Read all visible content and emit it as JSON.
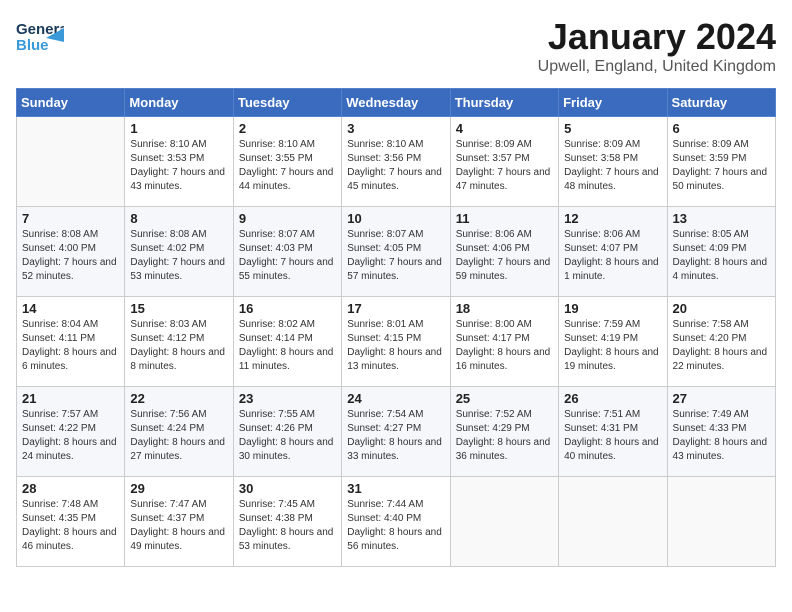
{
  "header": {
    "logo_line1": "General",
    "logo_line2": "Blue",
    "month": "January 2024",
    "location": "Upwell, England, United Kingdom"
  },
  "days_of_week": [
    "Sunday",
    "Monday",
    "Tuesday",
    "Wednesday",
    "Thursday",
    "Friday",
    "Saturday"
  ],
  "weeks": [
    [
      {
        "day": "",
        "info": ""
      },
      {
        "day": "1",
        "info": "Sunrise: 8:10 AM\nSunset: 3:53 PM\nDaylight: 7 hours\nand 43 minutes."
      },
      {
        "day": "2",
        "info": "Sunrise: 8:10 AM\nSunset: 3:55 PM\nDaylight: 7 hours\nand 44 minutes."
      },
      {
        "day": "3",
        "info": "Sunrise: 8:10 AM\nSunset: 3:56 PM\nDaylight: 7 hours\nand 45 minutes."
      },
      {
        "day": "4",
        "info": "Sunrise: 8:09 AM\nSunset: 3:57 PM\nDaylight: 7 hours\nand 47 minutes."
      },
      {
        "day": "5",
        "info": "Sunrise: 8:09 AM\nSunset: 3:58 PM\nDaylight: 7 hours\nand 48 minutes."
      },
      {
        "day": "6",
        "info": "Sunrise: 8:09 AM\nSunset: 3:59 PM\nDaylight: 7 hours\nand 50 minutes."
      }
    ],
    [
      {
        "day": "7",
        "info": "Sunrise: 8:08 AM\nSunset: 4:00 PM\nDaylight: 7 hours\nand 52 minutes."
      },
      {
        "day": "8",
        "info": "Sunrise: 8:08 AM\nSunset: 4:02 PM\nDaylight: 7 hours\nand 53 minutes."
      },
      {
        "day": "9",
        "info": "Sunrise: 8:07 AM\nSunset: 4:03 PM\nDaylight: 7 hours\nand 55 minutes."
      },
      {
        "day": "10",
        "info": "Sunrise: 8:07 AM\nSunset: 4:05 PM\nDaylight: 7 hours\nand 57 minutes."
      },
      {
        "day": "11",
        "info": "Sunrise: 8:06 AM\nSunset: 4:06 PM\nDaylight: 7 hours\nand 59 minutes."
      },
      {
        "day": "12",
        "info": "Sunrise: 8:06 AM\nSunset: 4:07 PM\nDaylight: 8 hours\nand 1 minute."
      },
      {
        "day": "13",
        "info": "Sunrise: 8:05 AM\nSunset: 4:09 PM\nDaylight: 8 hours\nand 4 minutes."
      }
    ],
    [
      {
        "day": "14",
        "info": "Sunrise: 8:04 AM\nSunset: 4:11 PM\nDaylight: 8 hours\nand 6 minutes."
      },
      {
        "day": "15",
        "info": "Sunrise: 8:03 AM\nSunset: 4:12 PM\nDaylight: 8 hours\nand 8 minutes."
      },
      {
        "day": "16",
        "info": "Sunrise: 8:02 AM\nSunset: 4:14 PM\nDaylight: 8 hours\nand 11 minutes."
      },
      {
        "day": "17",
        "info": "Sunrise: 8:01 AM\nSunset: 4:15 PM\nDaylight: 8 hours\nand 13 minutes."
      },
      {
        "day": "18",
        "info": "Sunrise: 8:00 AM\nSunset: 4:17 PM\nDaylight: 8 hours\nand 16 minutes."
      },
      {
        "day": "19",
        "info": "Sunrise: 7:59 AM\nSunset: 4:19 PM\nDaylight: 8 hours\nand 19 minutes."
      },
      {
        "day": "20",
        "info": "Sunrise: 7:58 AM\nSunset: 4:20 PM\nDaylight: 8 hours\nand 22 minutes."
      }
    ],
    [
      {
        "day": "21",
        "info": "Sunrise: 7:57 AM\nSunset: 4:22 PM\nDaylight: 8 hours\nand 24 minutes."
      },
      {
        "day": "22",
        "info": "Sunrise: 7:56 AM\nSunset: 4:24 PM\nDaylight: 8 hours\nand 27 minutes."
      },
      {
        "day": "23",
        "info": "Sunrise: 7:55 AM\nSunset: 4:26 PM\nDaylight: 8 hours\nand 30 minutes."
      },
      {
        "day": "24",
        "info": "Sunrise: 7:54 AM\nSunset: 4:27 PM\nDaylight: 8 hours\nand 33 minutes."
      },
      {
        "day": "25",
        "info": "Sunrise: 7:52 AM\nSunset: 4:29 PM\nDaylight: 8 hours\nand 36 minutes."
      },
      {
        "day": "26",
        "info": "Sunrise: 7:51 AM\nSunset: 4:31 PM\nDaylight: 8 hours\nand 40 minutes."
      },
      {
        "day": "27",
        "info": "Sunrise: 7:49 AM\nSunset: 4:33 PM\nDaylight: 8 hours\nand 43 minutes."
      }
    ],
    [
      {
        "day": "28",
        "info": "Sunrise: 7:48 AM\nSunset: 4:35 PM\nDaylight: 8 hours\nand 46 minutes."
      },
      {
        "day": "29",
        "info": "Sunrise: 7:47 AM\nSunset: 4:37 PM\nDaylight: 8 hours\nand 49 minutes."
      },
      {
        "day": "30",
        "info": "Sunrise: 7:45 AM\nSunset: 4:38 PM\nDaylight: 8 hours\nand 53 minutes."
      },
      {
        "day": "31",
        "info": "Sunrise: 7:44 AM\nSunset: 4:40 PM\nDaylight: 8 hours\nand 56 minutes."
      },
      {
        "day": "",
        "info": ""
      },
      {
        "day": "",
        "info": ""
      },
      {
        "day": "",
        "info": ""
      }
    ]
  ]
}
